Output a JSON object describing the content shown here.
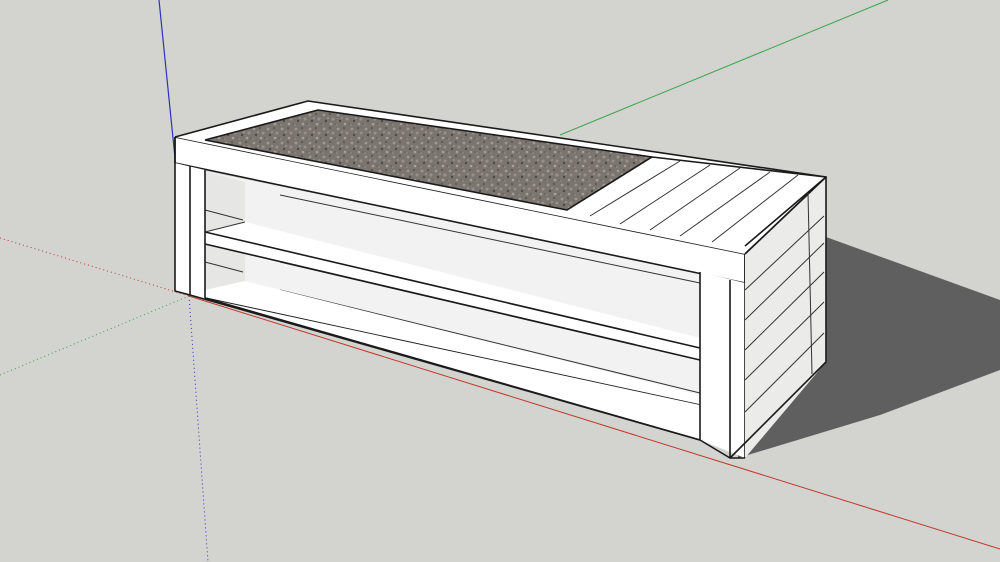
{
  "viewport": {
    "background_color": "#d3d3d0",
    "axes": {
      "red_axis_color": "#c0392b",
      "green_axis_color": "#3aa34a",
      "blue_axis_color": "#3030c0"
    },
    "model": {
      "face_light_color": "#ffffff",
      "face_shade_color": "#ebebea",
      "interior_shade_color": "#f2f2f2",
      "shadow_color": "#5f5f5f",
      "top_texture": "gravel-texture",
      "edge_color": "#1a1a1a"
    }
  }
}
